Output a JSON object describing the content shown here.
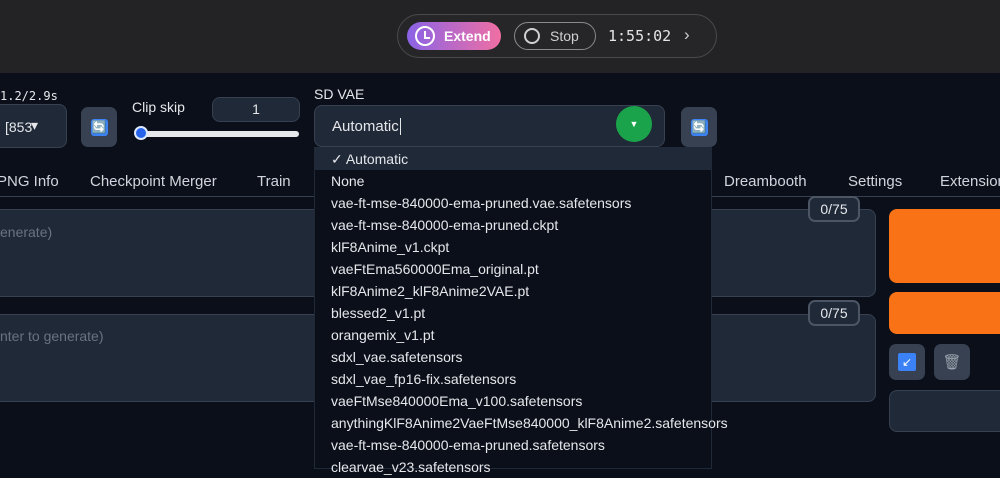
{
  "overlay": {
    "extend_label": "Extend",
    "stop_label": "Stop",
    "timer": "1:55:02",
    "chevron": "›"
  },
  "left": {
    "speed_text": "1.2/2.9s",
    "checkpoint_value": "[853",
    "checkpoint_caret": "▾"
  },
  "clip_skip": {
    "label": "Clip skip",
    "value": "1"
  },
  "sd_vae": {
    "label": "SD VAE",
    "value": "Automatic",
    "options": [
      "✓ Automatic",
      "None",
      "vae-ft-mse-840000-ema-pruned.vae.safetensors",
      "vae-ft-mse-840000-ema-pruned.ckpt",
      "klF8Anime_v1.ckpt",
      "vaeFtEma560000Ema_original.pt",
      "klF8Anime2_klF8Anime2VAE.pt",
      "blessed2_v1.pt",
      "orangemix_v1.pt",
      "sdxl_vae.safetensors",
      "sdxl_vae_fp16-fix.safetensors",
      "vaeFtMse840000Ema_v100.safetensors",
      "anythingKlF8Anime2VaeFtMse840000_klF8Anime2.safetensors",
      "vae-ft-mse-840000-ema-pruned.safetensors",
      "clearvae_v23.safetensors"
    ]
  },
  "tabs": {
    "png_info": "PNG Info",
    "checkpoint_merger": "Checkpoint Merger",
    "train": "Train",
    "dreambooth": "Dreambooth",
    "settings": "Settings",
    "extensions": "Extensions"
  },
  "prompts": {
    "positive_placeholder": "enerate)",
    "negative_placeholder": "nter to generate)",
    "positive_counter": "0/75",
    "negative_counter": "0/75"
  },
  "colors": {
    "accent_orange": "#f97316",
    "dropdown_green": "#1aa34a",
    "refresh_blue": "#3b82f6"
  },
  "icons": {
    "refresh": "🔄",
    "style_apply": "↙",
    "trash": "🗑"
  }
}
